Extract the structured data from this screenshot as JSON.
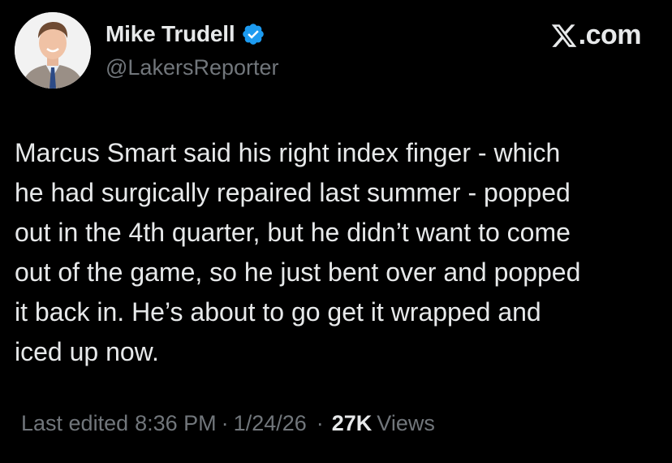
{
  "author": {
    "display_name": "Mike Trudell",
    "handle": "@LakersReporter",
    "verified_icon": "verified-badge-icon",
    "verified_color": "#1d9bf0"
  },
  "brand": {
    "logo_icon": "x-logo-icon",
    "suffix": ".com"
  },
  "tweet": {
    "text": "Marcus Smart said his right index finger - which\nhe had surgically repaired last summer - popped\nout in the 4th quarter, but he didn’t want to come\nout of the game, so he just bent over and popped\nit back in. He’s about to go get it wrapped and\niced up now."
  },
  "meta": {
    "edited_label": "Last edited",
    "time": "8:36 PM",
    "separator": "·",
    "date": "1/24/26",
    "views_count": "27K",
    "views_label": "Views"
  },
  "colors": {
    "background": "#000000",
    "primary_text": "#e7e9ea",
    "secondary_text": "#71767b"
  }
}
